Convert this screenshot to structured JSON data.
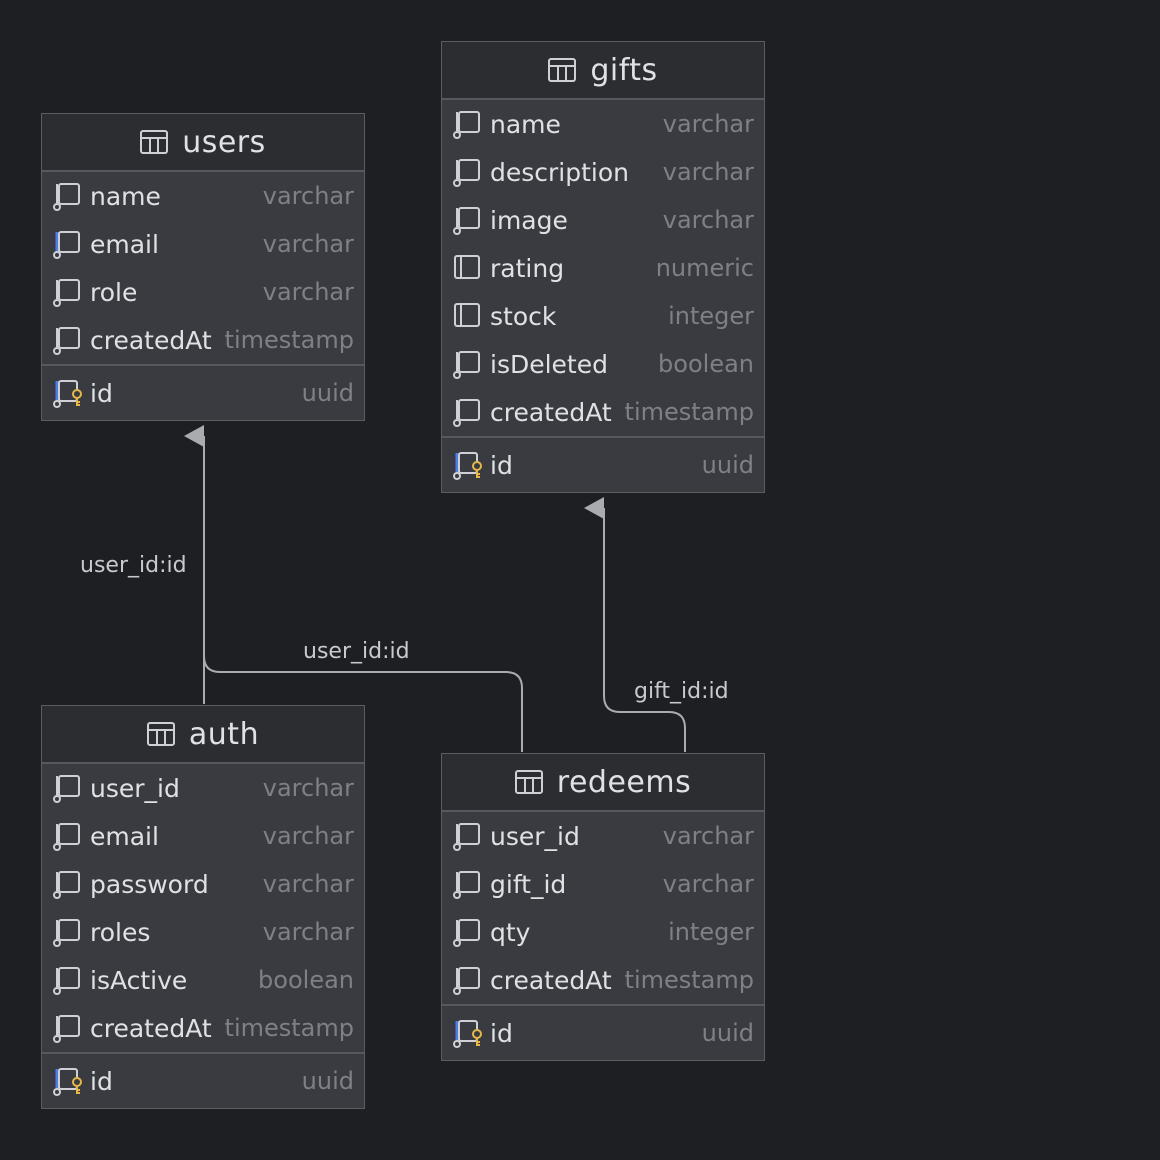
{
  "diagram": {
    "tables": [
      {
        "name": "users",
        "columns": [
          {
            "name": "name",
            "type": "varchar",
            "icon": "column-icon"
          },
          {
            "name": "email",
            "type": "varchar",
            "icon": "indexed-column-icon"
          },
          {
            "name": "role",
            "type": "varchar",
            "icon": "column-icon"
          },
          {
            "name": "createdAt",
            "type": "timestamp",
            "icon": "column-icon"
          }
        ],
        "primary_key": {
          "name": "id",
          "type": "uuid",
          "icon": "primary-key-icon"
        }
      },
      {
        "name": "gifts",
        "columns": [
          {
            "name": "name",
            "type": "varchar",
            "icon": "column-icon"
          },
          {
            "name": "description",
            "type": "varchar",
            "icon": "column-icon"
          },
          {
            "name": "image",
            "type": "varchar",
            "icon": "column-icon"
          },
          {
            "name": "rating",
            "type": "numeric",
            "icon": "not-null-column-icon"
          },
          {
            "name": "stock",
            "type": "integer",
            "icon": "not-null-column-icon"
          },
          {
            "name": "isDeleted",
            "type": "boolean",
            "icon": "column-icon"
          },
          {
            "name": "createdAt",
            "type": "timestamp",
            "icon": "column-icon"
          }
        ],
        "primary_key": {
          "name": "id",
          "type": "uuid",
          "icon": "primary-key-icon"
        }
      },
      {
        "name": "auth",
        "columns": [
          {
            "name": "user_id",
            "type": "varchar",
            "icon": "column-icon"
          },
          {
            "name": "email",
            "type": "varchar",
            "icon": "column-icon"
          },
          {
            "name": "password",
            "type": "varchar",
            "icon": "column-icon"
          },
          {
            "name": "roles",
            "type": "varchar",
            "icon": "column-icon"
          },
          {
            "name": "isActive",
            "type": "boolean",
            "icon": "column-icon"
          },
          {
            "name": "createdAt",
            "type": "timestamp",
            "icon": "column-icon"
          }
        ],
        "primary_key": {
          "name": "id",
          "type": "uuid",
          "icon": "primary-key-icon"
        }
      },
      {
        "name": "redeems",
        "columns": [
          {
            "name": "user_id",
            "type": "varchar",
            "icon": "column-icon"
          },
          {
            "name": "gift_id",
            "type": "varchar",
            "icon": "column-icon"
          },
          {
            "name": "qty",
            "type": "integer",
            "icon": "column-icon"
          },
          {
            "name": "createdAt",
            "type": "timestamp",
            "icon": "column-icon"
          }
        ],
        "primary_key": {
          "name": "id",
          "type": "uuid",
          "icon": "primary-key-icon"
        }
      }
    ],
    "relations": [
      {
        "from": "auth",
        "to": "users",
        "label": "user_id:id"
      },
      {
        "from": "redeems",
        "to": "users",
        "label": "user_id:id"
      },
      {
        "from": "redeems",
        "to": "gifts",
        "label": "gift_id:id"
      }
    ]
  },
  "colors": {
    "canvas": "#1e1f22",
    "table_body": "#393b40",
    "table_header": "#2b2d30",
    "edge": "#a9abb0",
    "key_accent": "#e6b84a",
    "index_accent": "#4d7ee8"
  }
}
